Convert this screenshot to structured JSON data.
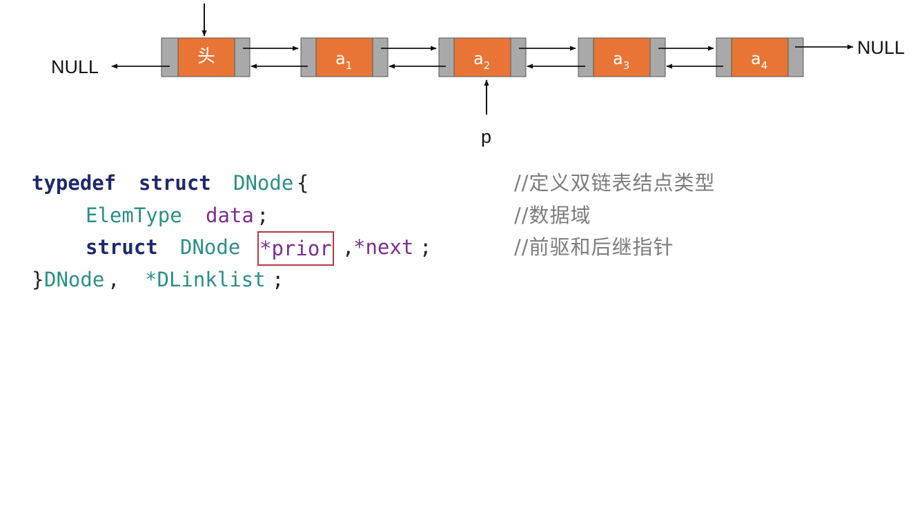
{
  "diagram": {
    "null_left": "NULL",
    "null_right": "NULL",
    "pointer_label": "p",
    "head_label": "头",
    "nodes": [
      {
        "base": "a",
        "sub": "1"
      },
      {
        "base": "a",
        "sub": "2"
      },
      {
        "base": "a",
        "sub": "3"
      },
      {
        "base": "a",
        "sub": "4"
      }
    ],
    "colors": {
      "node_data": "#e87535",
      "node_pointer": "#a9a9a9",
      "highlight_box": "#b03a3e"
    }
  },
  "code": {
    "line1": {
      "kw1": "typedef",
      "kw2": "struct",
      "type": "DNode",
      "brace": "{",
      "comment": "//定义双链表结点类型"
    },
    "line2": {
      "type": "ElemType",
      "field": "data",
      "semi": ";",
      "comment": "//数据域"
    },
    "line3": {
      "kw": "struct",
      "type": "DNode",
      "field1": "*prior",
      "sep": ",",
      "field2": "*next",
      "semi": ";",
      "comment": "//前驱和后继指针"
    },
    "line4": {
      "close": "}",
      "type1": "DNode",
      "sep": ", ",
      "type2": "*DLinklist",
      "semi": ";"
    }
  }
}
